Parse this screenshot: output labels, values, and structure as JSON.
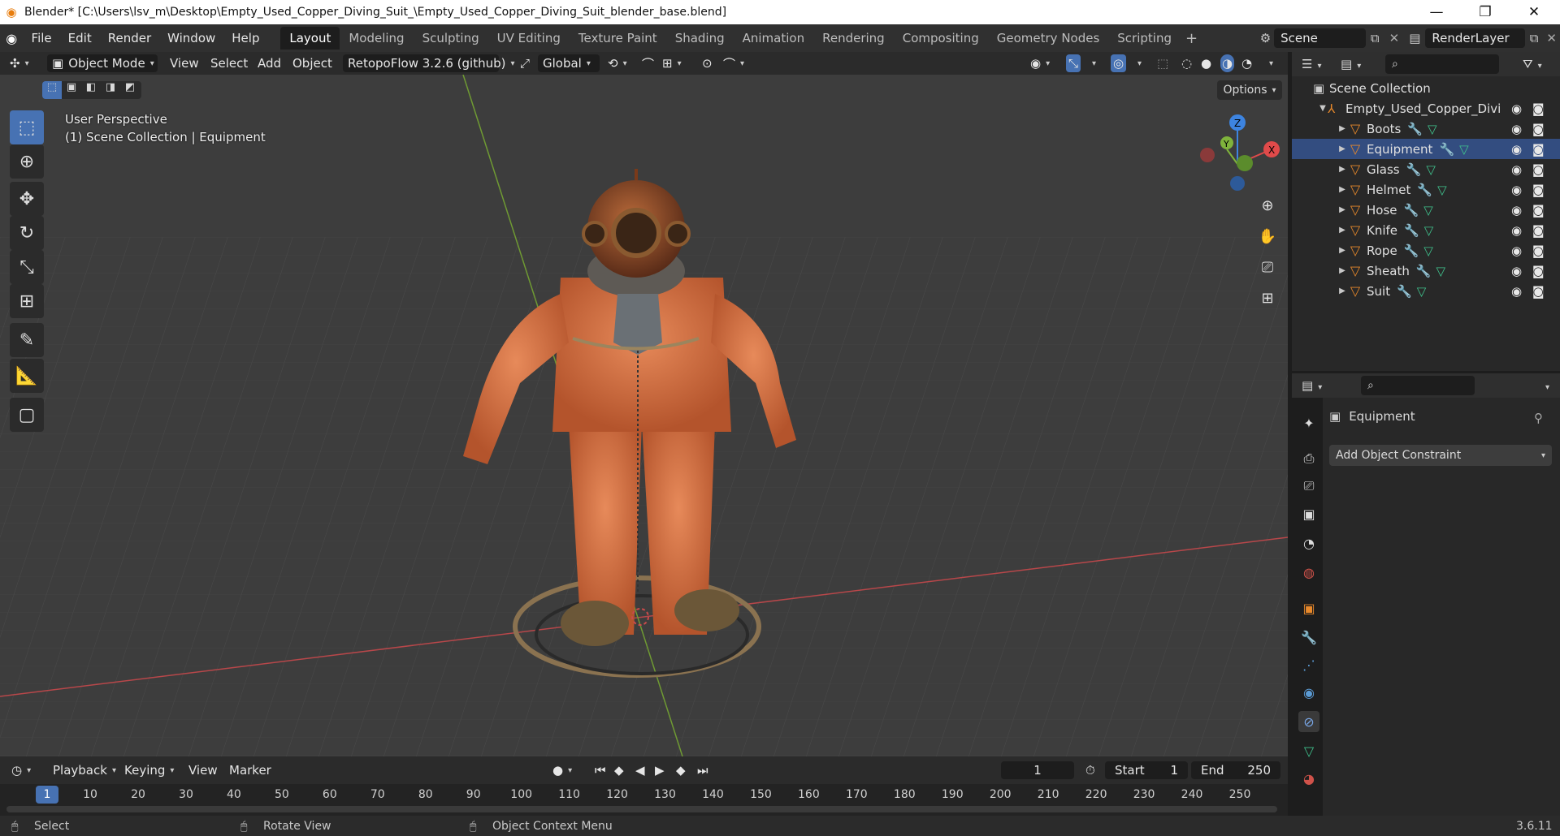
{
  "window": {
    "title": "Blender* [C:\\Users\\lsv_m\\Desktop\\Empty_Used_Copper_Diving_Suit_\\Empty_Used_Copper_Diving_Suit_blender_base.blend]"
  },
  "menu": [
    "File",
    "Edit",
    "Render",
    "Window",
    "Help"
  ],
  "workspaces": [
    "Layout",
    "Modeling",
    "Sculpting",
    "UV Editing",
    "Texture Paint",
    "Shading",
    "Animation",
    "Rendering",
    "Compositing",
    "Geometry Nodes",
    "Scripting"
  ],
  "scene": {
    "name": "Scene",
    "render_layer": "RenderLayer"
  },
  "header": {
    "mode": "Object Mode",
    "view": "View",
    "select": "Select",
    "add": "Add",
    "object": "Object",
    "addon": "RetopoFlow 3.2.6 (github)",
    "orientation": "Global",
    "options": "Options"
  },
  "viewport": {
    "perspective": "User Perspective",
    "collection_info": "(1) Scene Collection | Equipment"
  },
  "gizmo": {
    "x": "X",
    "y": "Y",
    "z": "Z"
  },
  "outliner": {
    "root": "Scene Collection",
    "collection": "Empty_Used_Copper_Divi",
    "items": [
      "Boots",
      "Equipment",
      "Glass",
      "Helmet",
      "Hose",
      "Knife",
      "Rope",
      "Sheath",
      "Suit"
    ],
    "selected": "Equipment"
  },
  "properties": {
    "object_name": "Equipment",
    "constraint_button": "Add Object Constraint"
  },
  "timeline": {
    "playback": "Playback",
    "keying": "Keying",
    "view": "View",
    "marker": "Marker",
    "current_frame": "1",
    "start_label": "Start",
    "start": "1",
    "end_label": "End",
    "end": "250",
    "ticks": [
      "1",
      "10",
      "20",
      "30",
      "40",
      "50",
      "60",
      "70",
      "80",
      "90",
      "100",
      "110",
      "120",
      "130",
      "140",
      "150",
      "160",
      "170",
      "180",
      "190",
      "200",
      "210",
      "220",
      "230",
      "240",
      "250"
    ]
  },
  "status": {
    "select": "Select",
    "rotate": "Rotate View",
    "context": "Object Context Menu",
    "version": "3.6.11"
  },
  "colors": {
    "accent": "#4772b3",
    "selection_bg": "#334d80",
    "object_orange": "#e8892b",
    "x_axis": "#e04a4a",
    "y_axis": "#7fb33c",
    "z_axis": "#3d84e0"
  }
}
